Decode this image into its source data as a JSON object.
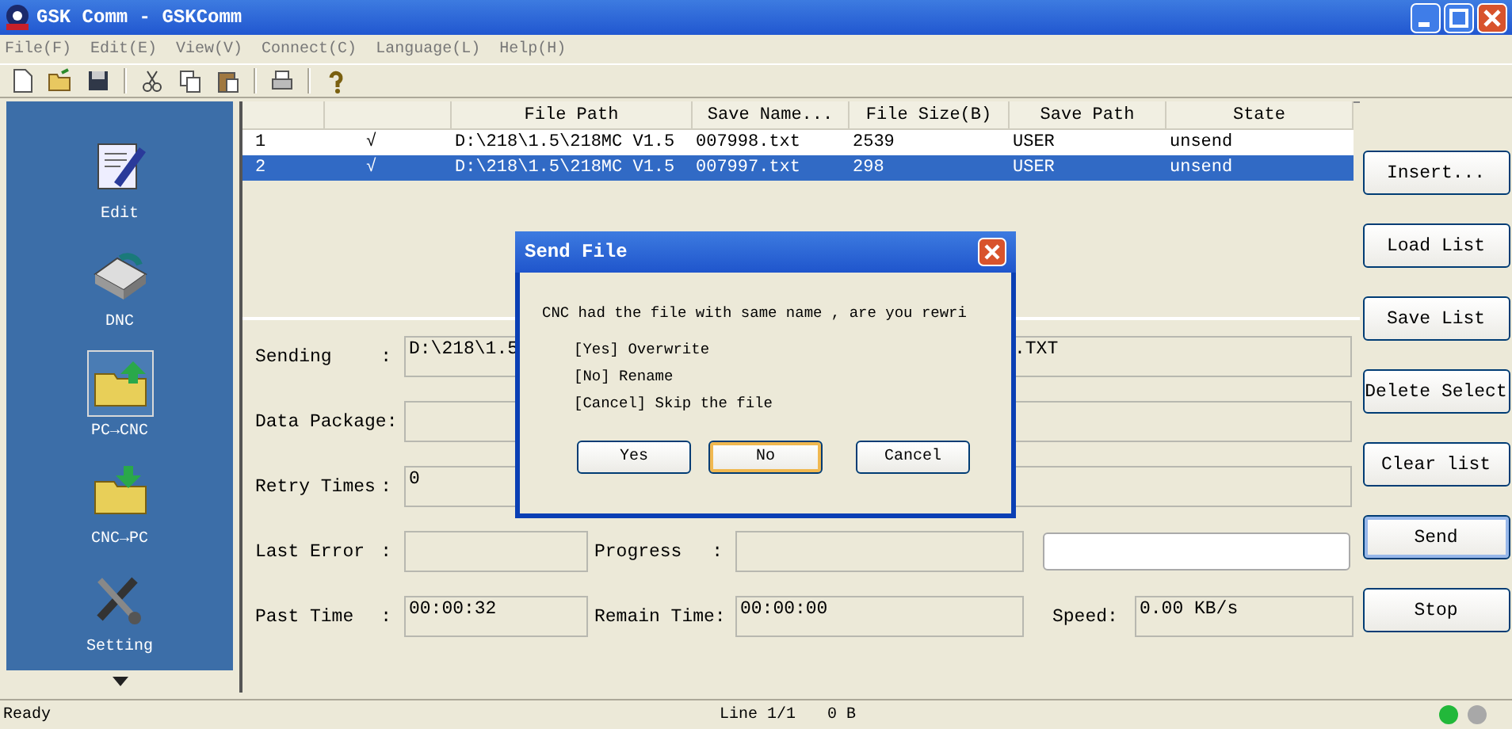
{
  "window": {
    "title": "GSK Comm - GSKComm"
  },
  "menu": [
    "File(F)",
    "Edit(E)",
    "View(V)",
    "Connect(C)",
    "Language(L)",
    "Help(H)"
  ],
  "sidebar": {
    "items": [
      {
        "label": "Edit",
        "selected": false
      },
      {
        "label": "DNC",
        "selected": false
      },
      {
        "label": "PC→CNC",
        "selected": true
      },
      {
        "label": "CNC→PC",
        "selected": false
      },
      {
        "label": "Setting",
        "selected": false
      }
    ]
  },
  "table": {
    "columns": [
      "",
      "",
      "File Path",
      "Save Name...",
      "File Size(B)",
      "Save Path",
      "State"
    ],
    "rows": [
      {
        "cells": [
          "1",
          "√",
          "D:\\218\\1.5\\218MC V1.5",
          "007998.txt",
          "2539",
          "USER",
          "unsend"
        ],
        "selected": false
      },
      {
        "cells": [
          "2",
          "√",
          "D:\\218\\1.5\\218MC V1.5",
          "007997.txt",
          "298",
          "USER",
          "unsend"
        ],
        "selected": true
      }
    ]
  },
  "form": [
    {
      "items": [
        {
          "kind": "label",
          "text": "Sending",
          "colon": ":"
        },
        {
          "kind": "field",
          "parts": [
            "D:\\218\\1.5",
            ".TXT"
          ]
        }
      ]
    },
    {
      "items": [
        {
          "kind": "label",
          "text": "Data Package:"
        },
        {
          "kind": "field"
        }
      ]
    },
    {
      "items": [
        {
          "kind": "label",
          "text": "Retry Times",
          "colon": ":"
        },
        {
          "kind": "field",
          "parts": [
            "0"
          ]
        }
      ]
    },
    {
      "items": [
        {
          "kind": "label",
          "text": "Last Error",
          "colon": ":"
        },
        {
          "kind": "field"
        },
        {
          "kind": "label2",
          "text": "Progress",
          "colon": ":"
        },
        {
          "kind": "field"
        },
        {
          "kind": "bar",
          "level": 0
        }
      ]
    },
    {
      "items": [
        {
          "kind": "label",
          "text": "Past Time",
          "colon": ":"
        },
        {
          "kind": "field",
          "parts": [
            "00:00:32"
          ]
        },
        {
          "kind": "label2",
          "text": "Remain Time:"
        },
        {
          "kind": "field",
          "parts": [
            "00:00:00"
          ]
        },
        {
          "kind": "label3",
          "text": "Speed:"
        },
        {
          "kind": "field",
          "parts": [
            "0.00 KB/s"
          ]
        }
      ]
    }
  ],
  "buttons": [
    {
      "label": "Insert...",
      "focused": false
    },
    {
      "label": "Load List",
      "focused": false
    },
    {
      "label": "Save List",
      "focused": false
    },
    {
      "label": "Delete Select",
      "focused": false
    },
    {
      "label": "Clear list",
      "focused": false
    },
    {
      "label": "Send",
      "focused": true
    },
    {
      "label": "Stop",
      "focused": false
    }
  ],
  "status_bar": {
    "message": "Ready",
    "line": "Line 1/1",
    "size": "0 B",
    "lights": [
      {
        "color": "#22b83a"
      },
      {
        "color": "#a8a8a8"
      }
    ]
  },
  "dialog": {
    "title": "Send File",
    "message": "CNC had the file with same name , are you rewri",
    "options": [
      "[Yes] Overwrite",
      "[No] Rename",
      "[Cancel] Skip the file"
    ],
    "buttons": [
      {
        "label": "Yes",
        "focused": false
      },
      {
        "label": "No",
        "focused": true
      },
      {
        "label": "Cancel",
        "focused": false
      }
    ]
  }
}
